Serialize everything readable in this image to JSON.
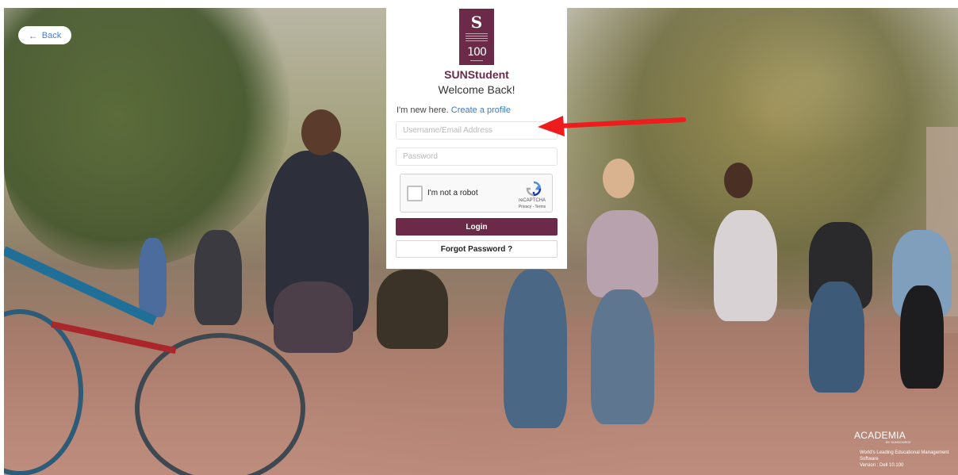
{
  "background": {
    "description_icon": "campus-photo"
  },
  "back_button": {
    "label": "Back",
    "icon": "arrow-left-icon"
  },
  "card": {
    "logo": {
      "monogram": "S",
      "number": "100"
    },
    "brand": "SUNStudent",
    "welcome": "Welcome Back!",
    "new_here_text": "I'm new here.",
    "create_profile_link": "Create a profile",
    "username_placeholder": "Username/Email Address",
    "password_placeholder": "Password",
    "captcha": {
      "label": "I'm not a robot",
      "brand": "reCAPTCHA",
      "links": "Privacy - Terms"
    },
    "login_label": "Login",
    "forgot_label": "Forgot Password ?"
  },
  "annotation": {
    "color": "#ee1c1c"
  },
  "colors": {
    "brand": "#6b2a47",
    "link": "#3b78c7"
  },
  "footer": {
    "product": "ACADEMIA",
    "by": "BY SUNSOURCE",
    "tagline": "World's Leading Educational Management Software",
    "version": "Version : Dell 10.100"
  }
}
